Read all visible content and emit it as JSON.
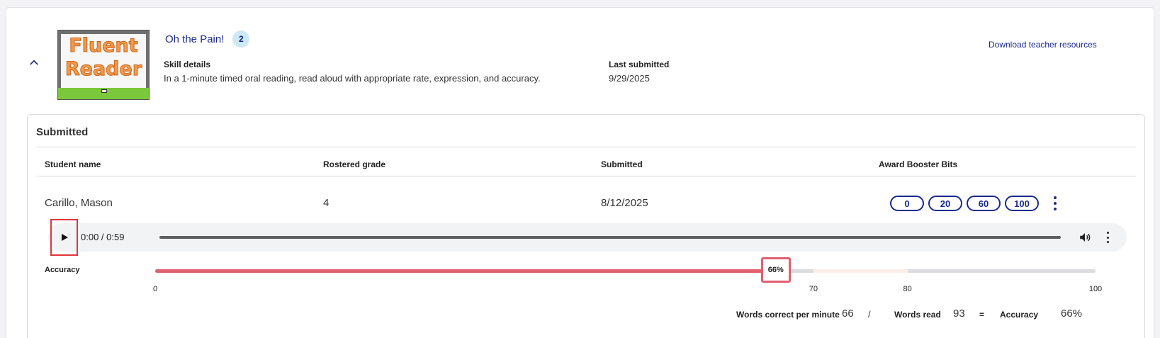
{
  "skill": {
    "title": "Oh the Pain!",
    "badge_count": "2",
    "details_label": "Skill details",
    "details_text": "In a 1-minute timed oral reading, read aloud with appropriate rate, expression, and accuracy.",
    "last_submitted_label": "Last submitted",
    "last_submitted_value": "9/29/2025",
    "download_link": "Download teacher resources",
    "thumbnail": {
      "line1": "Fluent",
      "line2": "Reader"
    }
  },
  "submitted": {
    "title": "Submitted",
    "columns": [
      "Student name",
      "Rostered grade",
      "Submitted",
      "Award Booster Bits"
    ],
    "row": {
      "student_name": "Carillo, Mason",
      "grade": "4",
      "submitted": "8/12/2025",
      "booster_options": [
        "0",
        "20",
        "60",
        "100"
      ]
    },
    "audio": {
      "time": "0:00 / 0:59"
    },
    "accuracy": {
      "label": "Accuracy",
      "value": 66,
      "marker_label": "66%",
      "ticks": [
        "0",
        "70",
        "80",
        "100"
      ],
      "zone_start": 70,
      "zone_end": 80
    },
    "summary": {
      "wcpm_label": "Words correct per minute",
      "wcpm_value": "66",
      "divider": "/",
      "words_read_label": "Words read",
      "words_read_value": "93",
      "equals": "=",
      "accuracy_label": "Accuracy",
      "accuracy_value": "66%"
    }
  },
  "colors": {
    "brand_navy": "#1a2a8c",
    "accuracy_fill": "#e06070",
    "highlight_red": "#e0353b",
    "badge_bg": "#cde9f6"
  }
}
